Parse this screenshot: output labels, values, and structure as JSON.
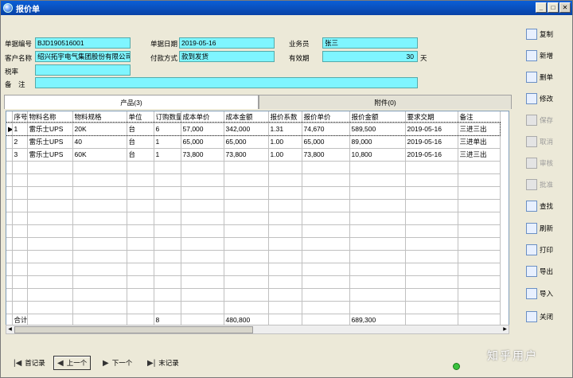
{
  "window": {
    "title": "报价单"
  },
  "form": {
    "doc_no_label": "单据编号",
    "doc_no": "BJD190516001",
    "date_label": "单据日期",
    "date": "2019-05-16",
    "sales_label": "业务员",
    "sales": "张三",
    "customer_label": "客户名称",
    "customer": "绍兴拓宇电气集团股份有限公司",
    "payment_label": "付款方式",
    "payment": "款到发货",
    "valid_label": "有效期",
    "valid": "30",
    "valid_unit": "天",
    "tax_label": "税率",
    "tax": "",
    "remark_label": "备　注",
    "remark": ""
  },
  "tabs": [
    {
      "label": "产品(3)",
      "active": true
    },
    {
      "label": "附件(0)",
      "active": false
    }
  ],
  "grid": {
    "columns": [
      "序号",
      "物料名称",
      "物料规格",
      "单位",
      "订购数量",
      "成本单价",
      "成本金额",
      "报价系数",
      "报价单价",
      "报价金额",
      "要求交期",
      "备注"
    ],
    "rows": [
      [
        "1",
        "雷乐士UPS",
        "20K",
        "台",
        "6",
        "57,000",
        "342,000",
        "1.31",
        "74,670",
        "589,500",
        "2019-05-16",
        "三进三出"
      ],
      [
        "2",
        "雷乐士UPS",
        "40",
        "台",
        "1",
        "65,000",
        "65,000",
        "1.00",
        "65,000",
        "89,000",
        "2019-05-16",
        "三进单出"
      ],
      [
        "3",
        "雷乐士UPS",
        "60K",
        "台",
        "1",
        "73,800",
        "73,800",
        "1.00",
        "73,800",
        "10,800",
        "2019-05-16",
        "三进三出"
      ]
    ],
    "total_label": "合计",
    "total_qty": "8",
    "total_cost": "480,800",
    "total_quote": "689,300",
    "row_marker": "▶"
  },
  "toolbar": {
    "copy": "复制",
    "new": "新增",
    "delete": "删单",
    "edit": "修改",
    "save": "保存",
    "cancel": "取消",
    "review": "审核",
    "approve": "批准",
    "find": "查找",
    "refresh": "刷新",
    "print": "打印",
    "export": "导出",
    "import": "导入",
    "close": "关闭"
  },
  "nav": {
    "first": "首记录",
    "prev": "上一个",
    "next": "下一个",
    "last": "末记录"
  },
  "watermark": "知乎用户",
  "colors": {
    "field_bg": "#7ff5ff",
    "title_bar": "#0a5fd6"
  }
}
